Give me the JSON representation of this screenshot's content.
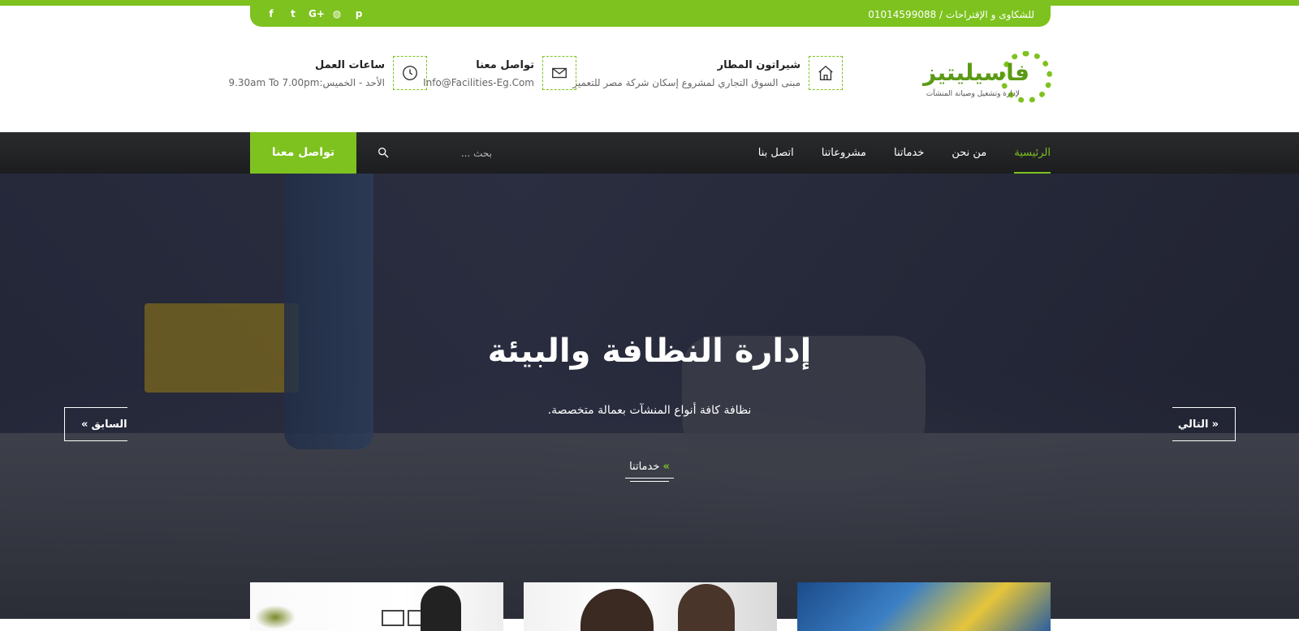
{
  "topbar": {
    "contact": "للشكاوى و الإقتراحات / 01014599088",
    "socials": [
      {
        "icon": "facebook-icon",
        "glyph": "f"
      },
      {
        "icon": "twitter-icon",
        "glyph": "t"
      },
      {
        "icon": "google-plus-icon",
        "glyph": "G+"
      },
      {
        "icon": "dribbble-icon",
        "glyph": "◍"
      },
      {
        "icon": "pinterest-icon",
        "glyph": "p"
      }
    ]
  },
  "logo": {
    "name": "فاسيليتيز",
    "tagline": "لإدارة وتشغيل وصيانة المنشآت"
  },
  "header_info": {
    "location": {
      "title": "شيراتون المطار",
      "text": "مبنى السوق التجاري لمشروع إسكان شركة مصر للتعمير"
    },
    "contact": {
      "title": "تواصل معنا",
      "text": "Info@Facilities-Eg.Com"
    },
    "hours": {
      "title": "ساعات العمل",
      "text": "الأحد - الخميس:9.30am To 7.00pm"
    }
  },
  "nav": {
    "items": [
      "الرئيسية",
      "من نحن",
      "خدماتنا",
      "مشروعاتنا",
      "اتصل بنا"
    ],
    "search_placeholder": "بحث ...",
    "cta": "تواصل معنا"
  },
  "hero": {
    "title": "إدارة النظافة والبيئة",
    "subtitle": "نظافة كافة أنواع المنشآت بعمالة متخصصة.",
    "more": "خدماتنا",
    "prev": "السابق",
    "next": "التالي"
  },
  "colors": {
    "accent": "#7dc21e",
    "nav_bg": "#222325"
  }
}
